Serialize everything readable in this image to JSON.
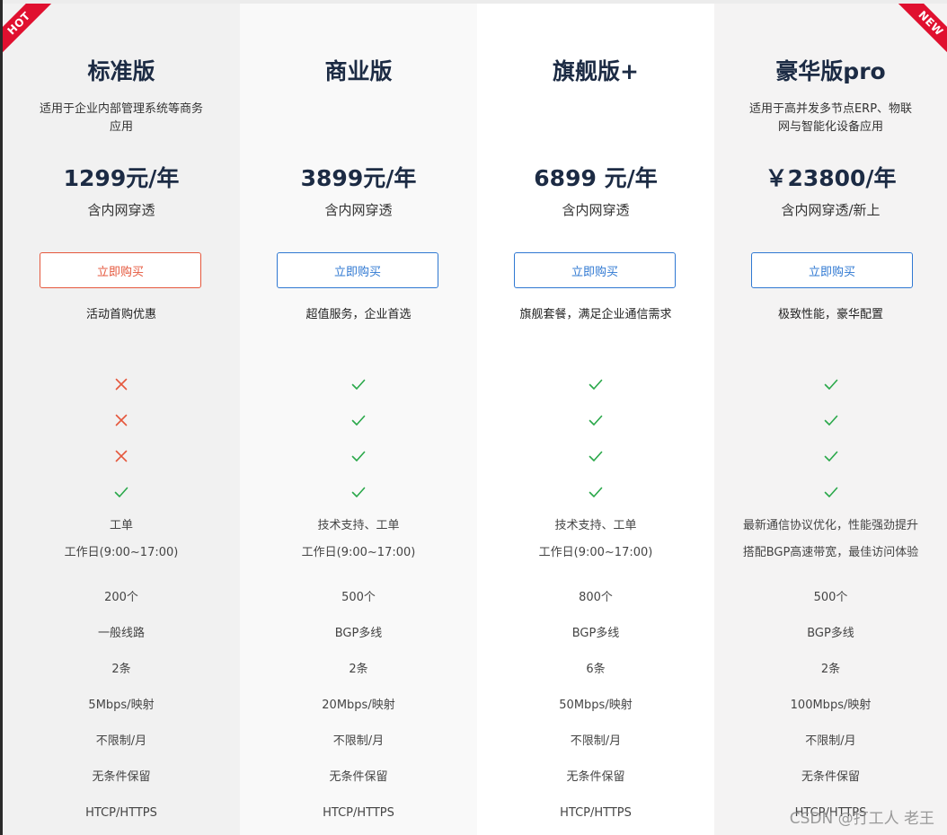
{
  "colors": {
    "check": "#2aa84a",
    "cross": "#e5573c",
    "accent": "#2f78d2",
    "ribbon": "#e0102f"
  },
  "plans": [
    {
      "ribbon": "HOT",
      "title": "标准版",
      "desc": "适用于企业内部管理系统等商务应用",
      "price": "1299元/年",
      "price_note": "含内网穿透",
      "buy_label": "立即购买",
      "tagline": "活动首购优惠",
      "features": [
        "cross",
        "cross",
        "cross",
        "check"
      ],
      "support_line1": "工单",
      "support_line2": "工作日(9:00~17:00)",
      "specs": [
        "200个",
        "一般线路",
        "2条",
        "5Mbps/映射",
        "不限制/月",
        "无条件保留",
        "HTCP/HTTPS"
      ]
    },
    {
      "title": "商业版",
      "desc": "",
      "price": "3899元/年",
      "price_note": "含内网穿透",
      "buy_label": "立即购买",
      "tagline": "超值服务，企业首选",
      "features": [
        "check",
        "check",
        "check",
        "check"
      ],
      "support_line1": "技术支持、工单",
      "support_line2": "工作日(9:00~17:00)",
      "specs": [
        "500个",
        "BGP多线",
        "2条",
        "20Mbps/映射",
        "不限制/月",
        "无条件保留",
        "HTCP/HTTPS"
      ]
    },
    {
      "title": "旗舰版+",
      "desc": "",
      "price": "6899 元/年",
      "price_note": "含内网穿透",
      "buy_label": "立即购买",
      "tagline": "旗舰套餐，满足企业通信需求",
      "features": [
        "check",
        "check",
        "check",
        "check"
      ],
      "support_line1": "技术支持、工单",
      "support_line2": "工作日(9:00~17:00)",
      "specs": [
        "800个",
        "BGP多线",
        "6条",
        "50Mbps/映射",
        "不限制/月",
        "无条件保留",
        "HTCP/HTTPS"
      ]
    },
    {
      "ribbon": "NEW",
      "title": "豪华版pro",
      "desc": "适用于高并发多节点ERP、物联网与智能化设备应用",
      "price": "￥23800/年",
      "price_note": "含内网穿透/新上",
      "buy_label": "立即购买",
      "tagline": "极致性能，豪华配置",
      "features": [
        "check",
        "check",
        "check",
        "check"
      ],
      "support_line1": "最新通信协议优化，性能强劲提升",
      "support_line2": "搭配BGP高速带宽，最佳访问体验",
      "specs": [
        "500个",
        "BGP多线",
        "2条",
        "100Mbps/映射",
        "不限制/月",
        "无条件保留",
        "HTCP/HTTPS"
      ]
    }
  ],
  "watermark": "CSDN @打工人 老王"
}
